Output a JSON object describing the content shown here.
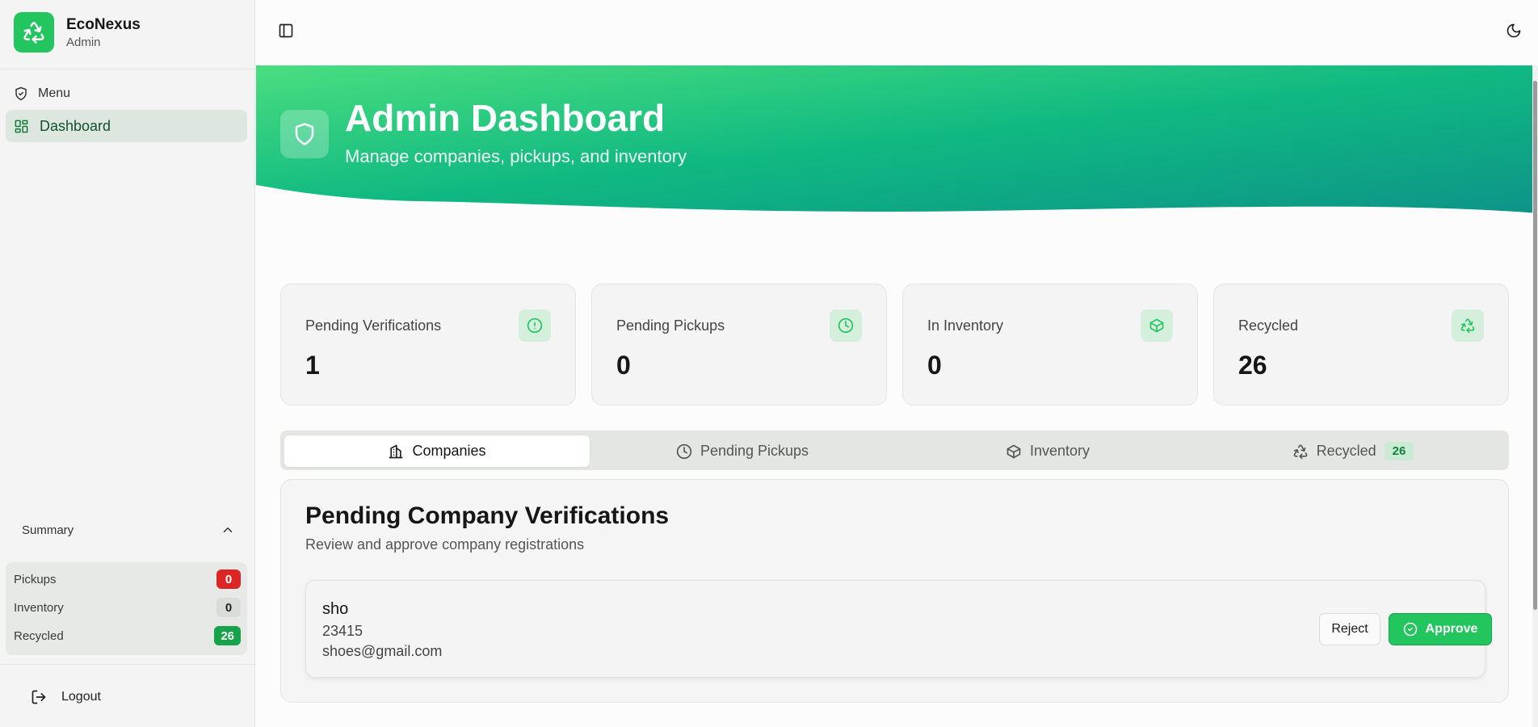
{
  "brand": {
    "name": "EcoNexus",
    "role": "Admin",
    "logo_icon": "recycle-icon",
    "color": "#22c55e"
  },
  "sidebar": {
    "menu_label": "Menu",
    "items": [
      {
        "label": "Dashboard",
        "icon": "layout-grid-icon",
        "active": true
      }
    ],
    "summary": {
      "title": "Summary",
      "rows": [
        {
          "label": "Pickups",
          "value": "0",
          "color": "#dc2626"
        },
        {
          "label": "Inventory",
          "value": "0",
          "color": "#d9dcd9"
        },
        {
          "label": "Recycled",
          "value": "26",
          "color": "#16a34a"
        }
      ]
    },
    "logout_label": "Logout"
  },
  "hero": {
    "title": "Admin Dashboard",
    "subtitle": "Manage companies, pickups, and inventory",
    "icon": "shield-icon",
    "gradient": [
      "#4ade80",
      "#10b981",
      "#0d9488"
    ]
  },
  "stats": [
    {
      "label": "Pending Verifications",
      "value": "1",
      "icon": "alert-circle-icon"
    },
    {
      "label": "Pending Pickups",
      "value": "0",
      "icon": "clock-icon"
    },
    {
      "label": "In Inventory",
      "value": "0",
      "icon": "package-icon"
    },
    {
      "label": "Recycled",
      "value": "26",
      "icon": "recycle-icon"
    }
  ],
  "tabs": [
    {
      "label": "Companies",
      "icon": "building-icon",
      "active": true
    },
    {
      "label": "Pending Pickups",
      "icon": "clock-icon"
    },
    {
      "label": "Inventory",
      "icon": "package-icon"
    },
    {
      "label": "Recycled",
      "icon": "recycle-icon",
      "badge": "26"
    }
  ],
  "panel": {
    "title": "Pending Company Verifications",
    "subtitle": "Review and approve company registrations",
    "companies": [
      {
        "name": "sho",
        "registration": "23415",
        "email": "shoes@gmail.com"
      }
    ],
    "reject_label": "Reject",
    "approve_label": "Approve"
  }
}
